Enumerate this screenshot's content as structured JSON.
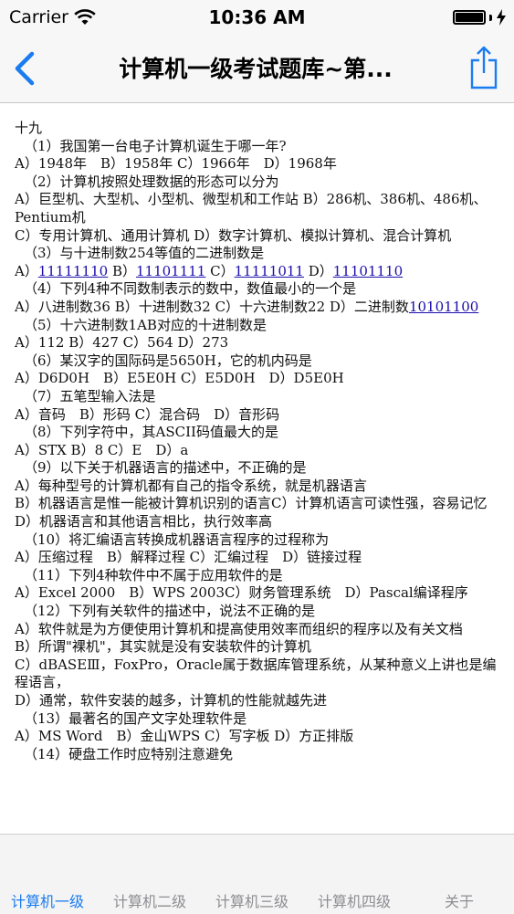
{
  "status_bar": {
    "carrier": "Carrier",
    "time": "10:36 AM"
  },
  "nav": {
    "title": "计算机一级考试题库~第...",
    "back_icon": "chevron-left-icon",
    "share_icon": "share-icon"
  },
  "content": {
    "lines": [
      "十九",
      "（1）我国第一台电子计算机诞生于哪一年?",
      "A）1948年　B）1958年 C）1966年　D）1968年",
      "（2）计算机按照处理数据的形态可以分为",
      "A）巨型机、大型机、小型机、微型机和工作站 B）286机、386机、486机、Pentium机",
      "C）专用计算机、通用计算机 D）数字计算机、模拟计算机、混合计算机",
      "（3）与十进制数254等值的二进制数是",
      "（4）下列4种不同数制表示的数中，数值最小的一个是",
      "（5）十六进制数1AB对应的十进制数是",
      "A）112 B）427 C）564 D）273",
      "（6）某汉字的国际码是5650H，它的机内码是",
      "A）D6D0H　B）E5E0H C）E5D0H　D）D5E0H",
      "（7）五笔型输入法是",
      "A）音码　B）形码 C）混合码　D）音形码",
      "（8）下列字符中，其ASCII码值最大的是",
      "A）STX B）8 C）E　D）a",
      "（9）以下关于机器语言的描述中，不正确的是",
      "A）每种型号的计算机都有自己的指令系统，就是机器语言",
      "B）机器语言是惟一能被计算机识别的语言C）计算机语言可读性强，容易记忆",
      "D）机器语言和其他语言相比，执行效率高",
      "（10）将汇编语言转换成机器语言程序的过程称为",
      "A）压缩过程　B）解释过程 C）汇编过程　D）链接过程",
      "（11）下列4种软件中不属于应用软件的是",
      "A）Excel 2000　B）WPS 2003C）财务管理系统　D）Pascal编译程序",
      "（12）下列有关软件的描述中，说法不正确的是",
      "A）软件就是为方便使用计算机和提高使用效率而组织的程序以及有关文档",
      "B）所谓\"裸机\"，其实就是没有安装软件的计算机",
      "C）dBASEⅢ，FoxPro，Oracle属于数据库管理系统，从某种意义上讲也是编程语言，",
      "D）通常，软件安装的越多，计算机的性能就越先进",
      "（13）最著名的国产文字处理软件是",
      "A）MS Word　B）金山WPS C）写字板 D）方正排版",
      "（14）硬盘工作时应特别注意避免"
    ],
    "q3_options": {
      "a_prefix": "A）",
      "a": "11111110",
      "b_prefix": " B）",
      "b": "11101111",
      "c_prefix": " C）",
      "c": "11111011",
      "d_prefix": " D）",
      "d": "11101110"
    },
    "q4_options": {
      "text": "A）八进制数36 B）十进制数32 C）十六进制数22 D）二进制数",
      "link": "10101100"
    }
  },
  "tabs": [
    {
      "label": "计算机一级",
      "active": true
    },
    {
      "label": "计算机二级",
      "active": false
    },
    {
      "label": "计算机三级",
      "active": false
    },
    {
      "label": "计算机四级",
      "active": false
    },
    {
      "label": "关于",
      "active": false
    }
  ],
  "colors": {
    "accent": "#1a7cf0",
    "link": "#1a0dab",
    "inactive_tab": "#8e8e93"
  }
}
